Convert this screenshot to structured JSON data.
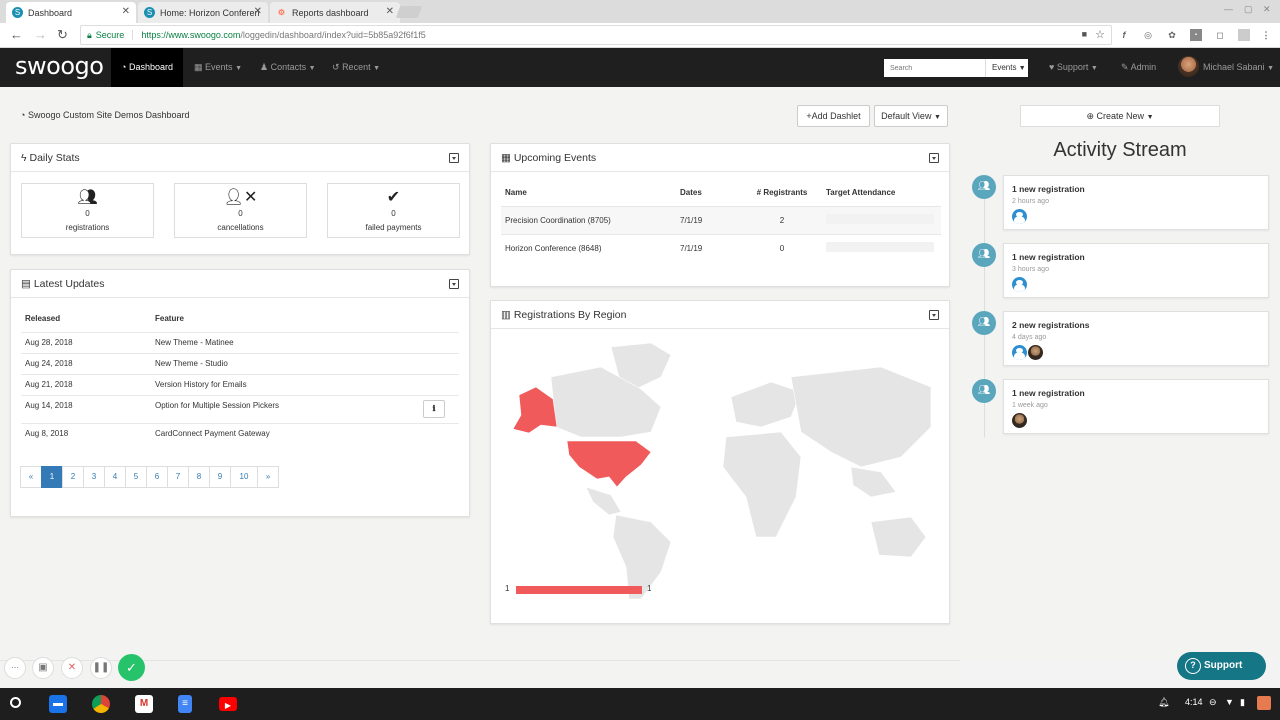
{
  "browser": {
    "tabs": [
      {
        "label": "Dashboard"
      },
      {
        "label": "Home: Horizon Conferen"
      },
      {
        "label": "Reports dashboard"
      }
    ],
    "secure_label": "Secure",
    "url_host": "https://www.swoogo.com",
    "url_path": "/loggedin/dashboard/index?uid=5b85a92f6f1f5"
  },
  "appnav": {
    "logo": "swoogo",
    "items": [
      {
        "label": "Dashboard"
      },
      {
        "label": "Events"
      },
      {
        "label": "Contacts"
      },
      {
        "label": "Recent"
      }
    ],
    "search_placeholder": "Search",
    "search_scope": "Events",
    "support": "Support",
    "admin": "Admin",
    "user": "Michael Sabani"
  },
  "dashboard": {
    "breadcrumb": "Swoogo Custom Site Demos Dashboard",
    "add_dashlet": "Add Dashlet",
    "default_view": "Default View"
  },
  "daily_stats": {
    "title": "Daily Stats",
    "stats": [
      {
        "value": "0",
        "label": "registrations"
      },
      {
        "value": "0",
        "label": "cancellations"
      },
      {
        "value": "0",
        "label": "failed payments"
      }
    ]
  },
  "latest_updates": {
    "title": "Latest Updates",
    "columns": [
      "Released",
      "Feature"
    ],
    "rows": [
      {
        "released": "Aug 28, 2018",
        "feature": "New Theme - Matinee"
      },
      {
        "released": "Aug 24, 2018",
        "feature": "New Theme - Studio"
      },
      {
        "released": "Aug 21, 2018",
        "feature": "Version History for Emails"
      },
      {
        "released": "Aug 14, 2018",
        "feature": "Option for Multiple Session Pickers"
      },
      {
        "released": "Aug 8, 2018",
        "feature": "CardConnect Payment Gateway"
      }
    ],
    "pages": [
      "«",
      "1",
      "2",
      "3",
      "4",
      "5",
      "6",
      "7",
      "8",
      "9",
      "10",
      "»"
    ],
    "active_page": "1"
  },
  "upcoming_events": {
    "title": "Upcoming Events",
    "columns": [
      "Name",
      "Dates",
      "# Registrants",
      "Target Attendance"
    ],
    "rows": [
      {
        "name": "Precision Coordination (8705)",
        "dates": "7/1/19",
        "registrants": "2"
      },
      {
        "name": "Horizon Conference (8648)",
        "dates": "7/1/19",
        "registrants": "0"
      }
    ]
  },
  "regions": {
    "title": "Registrations By Region",
    "legend_min": "1",
    "legend_max": "1",
    "highlight_color": "#f05a5a"
  },
  "activity": {
    "create_new": "Create New",
    "title": "Activity Stream",
    "items": [
      {
        "title": "1 new registration",
        "time": "2 hours ago"
      },
      {
        "title": "1 new registration",
        "time": "3 hours ago"
      },
      {
        "title": "2 new registrations",
        "time": "4 days ago"
      },
      {
        "title": "1 new registration",
        "time": "1 week ago"
      }
    ]
  },
  "support_widget": "Support",
  "taskbar": {
    "time": "4:14"
  }
}
